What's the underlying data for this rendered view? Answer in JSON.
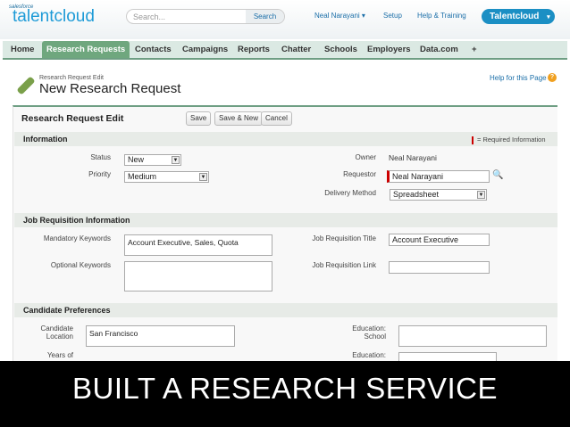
{
  "header": {
    "brand_prefix": "salesforce",
    "brand": "talentcloud",
    "search_placeholder": "Search...",
    "search_button": "Search",
    "user": "Neal Narayani",
    "setup": "Setup",
    "help": "Help & Training",
    "app": "Talentcloud"
  },
  "nav": {
    "tabs": [
      "Home",
      "Research Requests",
      "Contacts",
      "Campaigns",
      "Reports",
      "Chatter",
      "Schools",
      "Employers",
      "Data.com",
      "+"
    ],
    "active": "Research Requests"
  },
  "page": {
    "breadcrumb": "Research Request Edit",
    "title": "New Research Request",
    "help": "Help for this Page"
  },
  "form": {
    "title": "Research Request Edit",
    "buttons": [
      "Save",
      "Save & New",
      "Cancel"
    ],
    "required_note": "= Required Information",
    "information": {
      "header": "Information",
      "status_label": "Status",
      "status": "New",
      "priority_label": "Priority",
      "priority": "Medium",
      "owner_label": "Owner",
      "owner": "Neal Narayani",
      "requestor_label": "Requestor",
      "requestor": "Neal Narayani",
      "delivery_label": "Delivery Method",
      "delivery": "Spreadsheet"
    },
    "job": {
      "header": "Job Requisition Information",
      "mandatory_label": "Mandatory Keywords",
      "mandatory": "Account Executive, Sales, Quota",
      "optional_label": "Optional Keywords",
      "optional": "",
      "title_label": "Job Requisition Title",
      "title": "Account Executive",
      "link_label": "Job Requisition Link",
      "link": ""
    },
    "candidate": {
      "header": "Candidate Preferences",
      "location_label": "Candidate Location",
      "location": "San Francisco",
      "years_label": "Years of",
      "school_label": "Education: School",
      "edu2_label": "Education:"
    }
  },
  "banner": "BUILT A RESEARCH SERVICE",
  "colors": {
    "accent": "#1b8fc4",
    "tab_active": "#6fa77e",
    "required": "#cc0000"
  }
}
